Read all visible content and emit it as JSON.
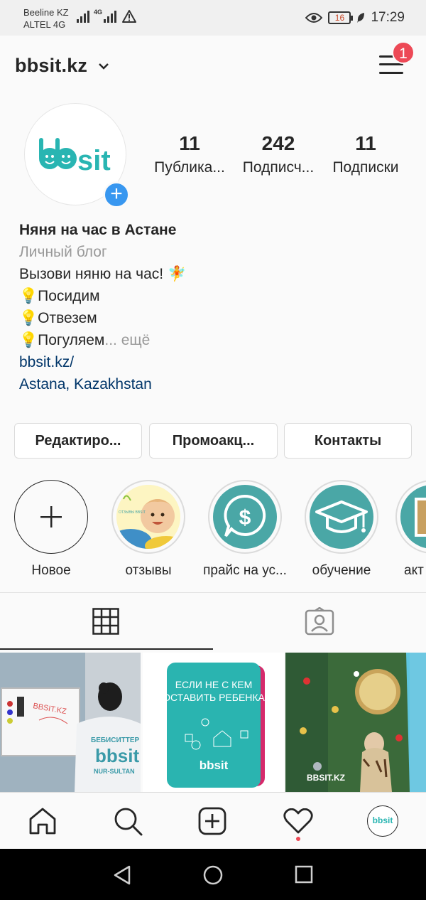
{
  "status_bar": {
    "carrier_1": "Beeline KZ",
    "carrier_2": "ALTEL 4G",
    "net_1": "4G",
    "battery": "16",
    "time": "17:29"
  },
  "header": {
    "username": "bbsit.kz",
    "notification_count": "1"
  },
  "profile": {
    "avatar_text": "bbsit",
    "stats": [
      {
        "value": "11",
        "label": "Публика..."
      },
      {
        "value": "242",
        "label": "Подписч..."
      },
      {
        "value": "11",
        "label": "Подписки"
      }
    ],
    "name": "Няня на час в Астане",
    "category": "Личный блог",
    "bio_line_1": "Вызови няню на час! 🧚",
    "bio_line_2": "💡Посидим",
    "bio_line_3": "💡Отвезем",
    "bio_line_4": "💡Погуляем",
    "more": "... ещё",
    "website": "bbsit.kz/",
    "location": "Astana, Kazakhstan"
  },
  "buttons": {
    "edit": "Редактиро...",
    "promo": "Промоакц...",
    "contacts": "Контакты"
  },
  "highlights": [
    {
      "label": "Новое"
    },
    {
      "label": "отзывы",
      "inner_text": "ОТЗЫВЫ BBSIT"
    },
    {
      "label": "прайс на ус..."
    },
    {
      "label": "обучение"
    },
    {
      "label": "акт"
    }
  ],
  "posts": [
    {
      "caption_1": "БЕБИСИТТЕР",
      "caption_2": "bbsit",
      "caption_3": "NUR-SULTAN",
      "board_text": "BBSIT.KZ"
    },
    {
      "line_1": "ЕСЛИ НЕ С КЕМ",
      "line_2": "ОСТАВИТЬ РЕБЕНКА",
      "logo": "bbsit"
    },
    {
      "watermark": "BBSIT.KZ"
    }
  ],
  "bottom_nav": {
    "profile_logo": "bbsit"
  },
  "colors": {
    "brand_teal": "#29b5b2",
    "accent_blue": "#3897f0",
    "badge_red": "#ed4956",
    "link_blue": "#003569"
  }
}
